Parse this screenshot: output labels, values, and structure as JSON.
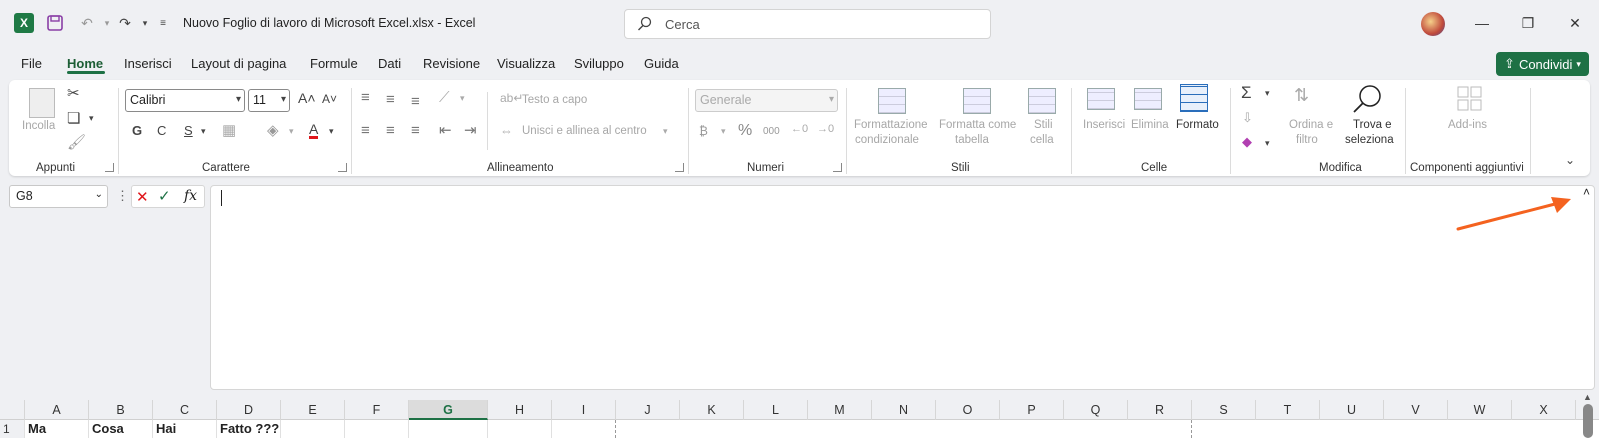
{
  "titlebar": {
    "title": "Nuovo Foglio di lavoro di Microsoft Excel.xlsx  -  Excel",
    "search_placeholder": "Cerca"
  },
  "menu": [
    "File",
    "Home",
    "Inserisci",
    "Layout di pagina",
    "Formule",
    "Dati",
    "Revisione",
    "Visualizza",
    "Sviluppo",
    "Guida"
  ],
  "share_label": "Condividi",
  "ribbon": {
    "appunti": {
      "title": "Appunti",
      "paste": "Incolla"
    },
    "carattere": {
      "title": "Carattere",
      "font": "Calibri",
      "size": "11",
      "bold": "G",
      "italic": "C",
      "underline": "S"
    },
    "allineamento": {
      "title": "Allineamento",
      "wrap": "Testo a capo",
      "merge": "Unisci e allinea al centro"
    },
    "numeri": {
      "title": "Numeri",
      "format": "Generale"
    },
    "stili": {
      "title": "Stili",
      "cond_1": "Formattazione",
      "cond_2": "condizionale",
      "table_1": "Formatta come",
      "table_2": "tabella",
      "cell_1": "Stili",
      "cell_2": "cella"
    },
    "celle": {
      "title": "Celle",
      "insert": "Inserisci",
      "delete": "Elimina",
      "format": "Formato"
    },
    "modifica": {
      "title": "Modifica",
      "sort_1": "Ordina e",
      "sort_2": "filtro",
      "find_1": "Trova e",
      "find_2": "seleziona"
    },
    "addins": {
      "title": "Componenti aggiuntivi",
      "label": "Add-ins"
    }
  },
  "formula": {
    "namebox": "G8",
    "fx": "fx"
  },
  "columns": [
    "A",
    "B",
    "C",
    "D",
    "E",
    "F",
    "G",
    "H",
    "I",
    "J",
    "K",
    "L",
    "M",
    "N",
    "O",
    "P",
    "Q",
    "R",
    "S",
    "T",
    "U",
    "V",
    "W",
    "X"
  ],
  "row1": {
    "num": "1",
    "A": "Ma",
    "B": "Cosa",
    "C": "Hai",
    "D": "Fatto ???"
  },
  "colors": {
    "accent": "#1e7145",
    "arrow": "#f4621f"
  }
}
